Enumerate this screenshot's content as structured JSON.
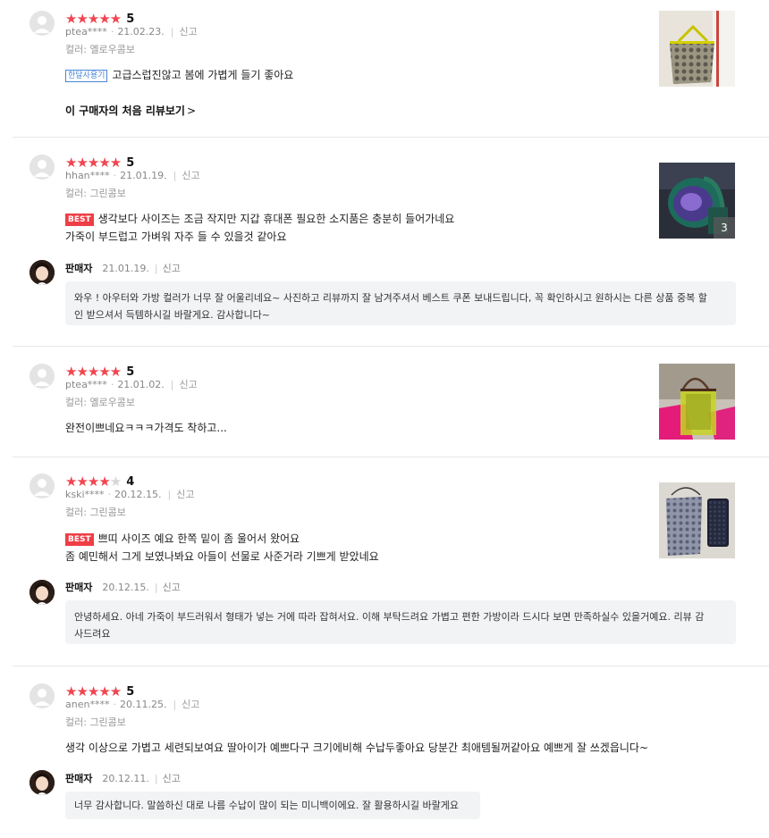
{
  "report_label": "신고",
  "seller_label": "판매자",
  "first_review_link": "이 구매자의 처음 리뷰보기",
  "month_tag": "한달사용기",
  "best_tag": "BEST",
  "reviews": [
    {
      "rating": 5,
      "stars_filled": 5,
      "user": "ptea****",
      "date": "21.02.23.",
      "option": "컬러: 옐로우콤보",
      "lines": [
        "고급스럽진않고 봄에 가볍게 들기 좋아요"
      ]
    },
    {
      "rating": 5,
      "stars_filled": 5,
      "user": "hhan****",
      "date": "21.01.19.",
      "option": "컬러: 그린콤보",
      "lines": [
        "생각보다 사이즈는 조금 작지만 지갑 휴대폰 필요한 소지품은 충분히 들어가네요",
        "가죽이 부드럽고 가벼워 자주 들 수 있을것 같아요"
      ],
      "photo_count": "3",
      "reply_date": "21.01.19.",
      "reply_lines": [
        "와우 ! 아우터와 가방 컬러가 너무 잘 어울리네요~ 사진하고 리뷰까지 잘 남겨주셔서 베스트 쿠폰 보내드립니다, 꼭 확인하시고 원하시는 다른 상품 중복 할",
        "인 받으셔서 득템하시길 바랄게요. 감사합니다~"
      ]
    },
    {
      "rating": 5,
      "stars_filled": 5,
      "user": "ptea****",
      "date": "21.01.02.",
      "option": "컬러: 옐로우콤보",
      "lines": [
        "완전이쁘네요ㅋㅋㅋ가격도 착하고..."
      ]
    },
    {
      "rating": 4,
      "stars_filled": 4,
      "user": "kski****",
      "date": "20.12.15.",
      "option": "컬러: 그린콤보",
      "lines": [
        "쁘띠 사이즈 예요 한쪽 밑이 좀 울어서 왔어요",
        "좀 예민해서 그게 보였나봐요 아들이 선물로 사준거라 기쁘게 받았네요"
      ],
      "reply_date": "20.12.15.",
      "reply_lines": [
        "안녕하세요. 아네 가죽이 부드러워서 형태가 넣는 거에 따라 잡혀서요. 이해 부탁드려요 가볍고 편한 가방이라 드시다 보면 만족하실수 있을거예요. 리뷰 감",
        "사드려요"
      ]
    },
    {
      "rating": 5,
      "stars_filled": 5,
      "user": "anen****",
      "date": "20.11.25.",
      "option": "컬러: 그린콤보",
      "lines": [
        "생각 이상으로 가볍고 세련되보여요  딸아이가   예쁘다구  크기에비해  수납두좋아요 당분간 최애템될꺼같아요  예쁘게 잘 쓰겠읍니다~"
      ],
      "reply_date": "20.12.11.",
      "reply_lines": [
        "너무 감사합니다. 말씀하신 대로 나름 수납이 많이 되는 미니백이에요. 잘 활용하시길 바랄게요"
      ]
    }
  ],
  "colors": {
    "star": "#f1454f",
    "best_tag": "#ef3e45",
    "month_tag": "#4a87d8",
    "reply_bg": "#f2f3f5"
  }
}
